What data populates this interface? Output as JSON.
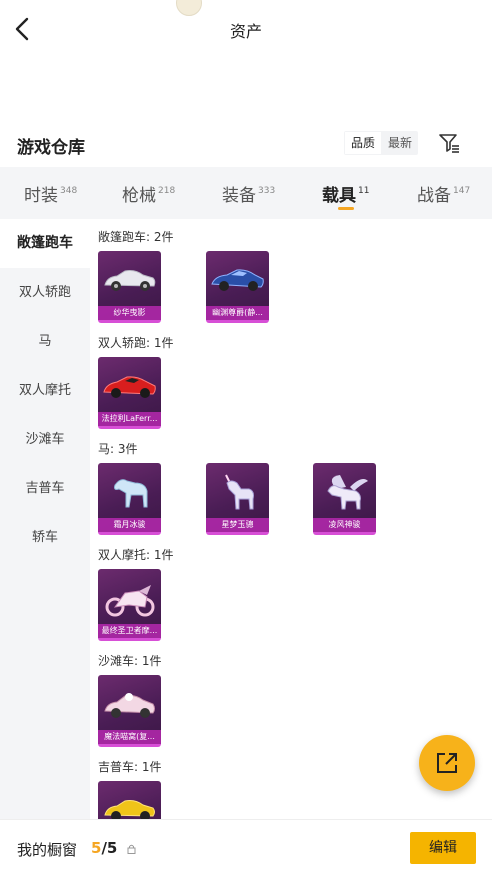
{
  "header": {
    "title": "资产"
  },
  "warehouse": {
    "title": "游戏仓库",
    "sort_options": [
      "品质",
      "最新"
    ],
    "active_sort": "最新"
  },
  "tabs": [
    {
      "label": "时装",
      "count": "348"
    },
    {
      "label": "枪械",
      "count": "218"
    },
    {
      "label": "装备",
      "count": "333"
    },
    {
      "label": "载具",
      "count": "11",
      "active": true
    },
    {
      "label": "战备",
      "count": "147"
    }
  ],
  "sidebar": {
    "items": [
      {
        "label": "敞篷跑车",
        "active": true
      },
      {
        "label": "双人轿跑"
      },
      {
        "label": "马"
      },
      {
        "label": "双人摩托"
      },
      {
        "label": "沙滩车"
      },
      {
        "label": "吉普车"
      },
      {
        "label": "轿车"
      }
    ]
  },
  "groups": [
    {
      "title": "敞篷跑车: 2件",
      "items": [
        {
          "name": "纱华曳影",
          "icon": "convertible-car-icon"
        },
        {
          "name": "幽渊尊爵(静...",
          "icon": "sports-car-icon"
        }
      ]
    },
    {
      "title": "双人轿跑: 1件",
      "items": [
        {
          "name": "法拉利LaFerr...",
          "icon": "supercar-icon"
        }
      ]
    },
    {
      "title": "马: 3件",
      "items": [
        {
          "name": "霜月冰骏",
          "icon": "horse-icon"
        },
        {
          "name": "星梦玉骢",
          "icon": "unicorn-icon"
        },
        {
          "name": "凌风神骏",
          "icon": "pegasus-icon"
        }
      ]
    },
    {
      "title": "双人摩托: 1件",
      "items": [
        {
          "name": "最终圣卫者摩...",
          "icon": "motorcycle-icon"
        }
      ]
    },
    {
      "title": "沙滩车: 1件",
      "items": [
        {
          "name": "魔法喵窝(复...",
          "icon": "beach-buggy-icon"
        }
      ]
    },
    {
      "title": "吉普车: 1件",
      "items": [
        {
          "name": "",
          "icon": "jeep-icon"
        }
      ]
    }
  ],
  "bottom": {
    "label": "我的橱窗",
    "current": "5",
    "total": "/5",
    "edit_label": "编辑"
  },
  "colors": {
    "accent": "#f5a623",
    "button": "#f5b400",
    "card_bg": "#4a1d55",
    "card_label": "#af28aa"
  }
}
